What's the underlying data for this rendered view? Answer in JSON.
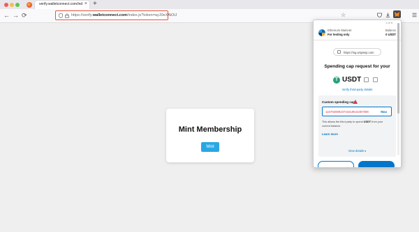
{
  "browser": {
    "tab_title": "verify.walletconnect.com/index.js?t",
    "tab_close": "×",
    "new_tab": "+",
    "url_prefix": "https://verify.",
    "url_domain": "walletconnect.com",
    "url_path": "/index.js?token=ayJ0eXAiOiJ",
    "back_glyph": "←",
    "forward_glyph": "→",
    "reload_glyph": "⟳",
    "star_glyph": "☆",
    "icons": [
      "shield-icon",
      "lock-icon",
      "bookmark-star-icon",
      "pocket-icon",
      "download-icon",
      "extensions-icon",
      "metamask-icon",
      "menu-icon"
    ]
  },
  "page": {
    "title": "Mint Membership",
    "mint_button": "Mint",
    "accent": "#2aa7e3"
  },
  "metamask": {
    "pager": "1 of 5",
    "network": "Ethereum Mainnet",
    "account": "For testing only",
    "balance_label": "Balance",
    "balance_value": "0 USDT",
    "origin": "https://mg.wspwsp.com",
    "heading": "Spending cap request for your",
    "token": "USDT",
    "verify_link": "Verify third-party details",
    "cap_label": "Custom spending cap",
    "cap_value": "11579208923731619542357098",
    "max_label": "Max",
    "desc_prefix": "This allows the third party to spend",
    "desc_token": "USDT",
    "desc_suffix": "from your current balance.",
    "learn_more": "Learn more",
    "view_details": "View details ▾",
    "accent": "#0376c9",
    "error_color": "#d73847"
  }
}
